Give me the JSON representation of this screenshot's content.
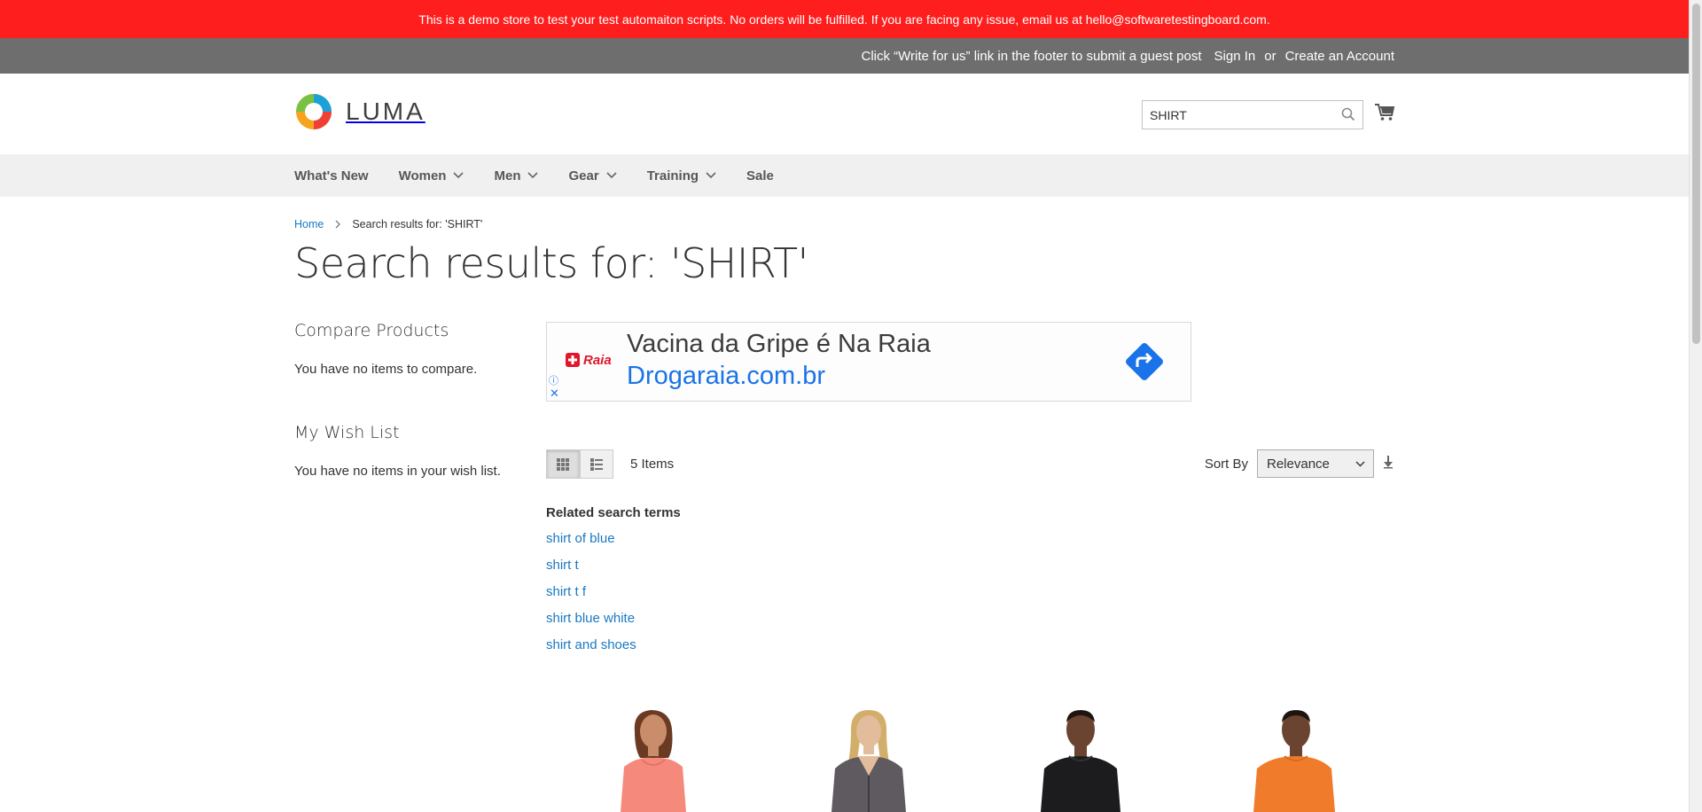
{
  "demo_notice": "This is a demo store to test your test automaiton scripts. No orders will be fulfilled. If you are facing any issue, email us at hello@softwaretestingboard.com.",
  "top_bar": {
    "guest_post_text": "Click “Write for us” link in the footer to submit a guest post",
    "sign_in": "Sign In",
    "or": "or",
    "create_account": "Create an Account"
  },
  "header": {
    "logo_text": "LUMA",
    "search_value": "SHIRT"
  },
  "nav": {
    "items": [
      {
        "label": "What's New",
        "dropdown": false
      },
      {
        "label": "Women",
        "dropdown": true
      },
      {
        "label": "Men",
        "dropdown": true
      },
      {
        "label": "Gear",
        "dropdown": true
      },
      {
        "label": "Training",
        "dropdown": true
      },
      {
        "label": "Sale",
        "dropdown": false
      }
    ]
  },
  "breadcrumb": {
    "home": "Home",
    "current": "Search results for: 'SHIRT'"
  },
  "page_title": "Search results for: 'SHIRT'",
  "sidebar": {
    "compare_title": "Compare Products",
    "compare_text": "You have no items to compare.",
    "wishlist_title": "My Wish List",
    "wishlist_text": "You have no items in your wish list."
  },
  "ad": {
    "brand": "Raia",
    "title": "Vacina da Gripe é Na Raia",
    "url": "Drogaraia.com.br",
    "close": "✕",
    "info": "ⓘ"
  },
  "toolbar": {
    "count": "5 Items",
    "sort_label": "Sort By",
    "sort_value": "Relevance"
  },
  "related": {
    "title": "Related search terms",
    "terms": [
      "shirt of blue",
      "shirt t",
      "shirt t f",
      "shirt blue white",
      "shirt and shoes"
    ]
  },
  "colors": {
    "demo_bar": "#ff1e1e",
    "top_bar": "#6e6e6e",
    "link": "#1979c3",
    "nav_bg": "#f0f0f0"
  }
}
